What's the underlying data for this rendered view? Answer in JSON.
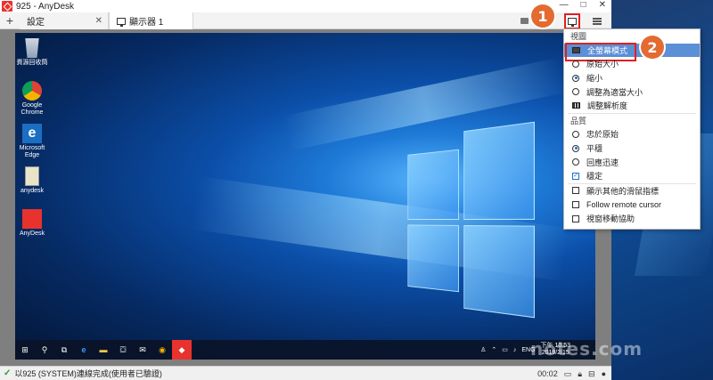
{
  "window": {
    "title": "925        - AnyDesk",
    "controls": [
      "—",
      "□",
      "✕"
    ]
  },
  "tabs": [
    {
      "label": "設定"
    },
    {
      "label": "顯示器 1"
    }
  ],
  "menu": {
    "section_view": "視圖",
    "view_items": [
      {
        "label": "全螢幕模式",
        "state": "highlight"
      },
      {
        "label": "原始大小",
        "state": "radio-off"
      },
      {
        "label": "縮小",
        "state": "radio-on"
      },
      {
        "label": "調整為適當大小",
        "state": "radio-off"
      },
      {
        "label": "調整解析度",
        "state": "icon"
      }
    ],
    "section_quality": "品質",
    "quality_items": [
      {
        "label": "忠於原始",
        "state": "radio-off"
      },
      {
        "label": "平穩",
        "state": "radio-on"
      },
      {
        "label": "回應迅速",
        "state": "radio-off"
      },
      {
        "label": "穩定",
        "state": "check-on"
      }
    ],
    "other_items": [
      {
        "label": "顯示其他的滑鼠指標",
        "state": "check-off"
      },
      {
        "label": "Follow remote cursor",
        "state": "check-off"
      },
      {
        "label": "視窗移動協助",
        "state": "check-off"
      }
    ]
  },
  "desktop_icons": [
    {
      "label": "資源回收筒",
      "icon": "recycle-bin-icon"
    },
    {
      "label": "Google Chrome",
      "icon": "chrome-icon"
    },
    {
      "label": "Microsoft Edge",
      "icon": "edge-icon"
    },
    {
      "label": "anydesk",
      "icon": "file-icon"
    },
    {
      "label": "AnyDesk",
      "icon": "anydesk-icon"
    }
  ],
  "taskbar": {
    "lang": "ENG",
    "time": "下午 10:53",
    "date": "2019/2/15"
  },
  "annotations": [
    "1",
    "2"
  ],
  "status": {
    "text": "以925        (SYSTEM)連線完成(使用者已驗證)",
    "timer": "00:02"
  },
  "watermark": "notes.com",
  "colors": {
    "accent_red": "#e02020",
    "badge_orange": "#e36a30",
    "menu_highlight": "#5b8fd6"
  }
}
